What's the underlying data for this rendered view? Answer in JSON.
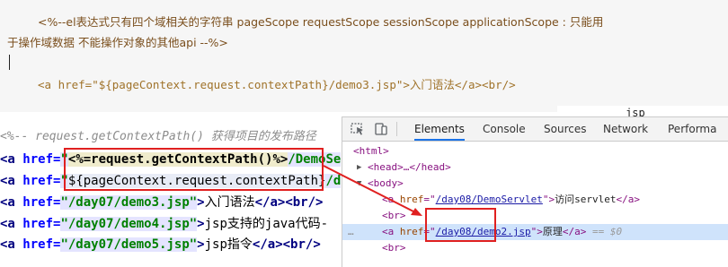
{
  "article": {
    "line1": "<%--el表达式只有四个域相关的字符串 pageScope requestScope sessionScope applicationScope : 只能用",
    "line2": "于操作域数据 不能操作对象的其他api --%>",
    "line3": "<a href=\"${pageContext.request.contextPath}/demo3.jsp\">入门语法</a><br/>"
  },
  "editor": {
    "comment": "<%-- request.getContextPath() 获得项目的发布路径",
    "line1": {
      "open": "<a ",
      "attr": "href=",
      "quote": "\"",
      "jsp": "<%=request.getContextPath()%>",
      "rest": "/DemoSe"
    },
    "line2": {
      "open": "<a ",
      "attr": "href=",
      "quote": "\"",
      "el": "${pageContext.request.contextPath}",
      "rest": "/d"
    },
    "line3": {
      "open": "<a ",
      "attr": "href=",
      "val": "\"/day07/demo3.jsp\"",
      "close": ">",
      "text": "入门语法",
      "end": "</a><br/>"
    },
    "line4": {
      "open": "<a ",
      "attr": "href=",
      "val": "\"/day07/demo4.jsp\"",
      "close": ">",
      "text": "jsp支持的java代码-"
    },
    "line5": {
      "open": "<a ",
      "attr": "href=",
      "val": "\"/day07/demo5.jsp\"",
      "close": ">",
      "text": "jsp指令",
      "end": "</a><br/>"
    }
  },
  "devtools": {
    "window_title": "jsp",
    "tabs": [
      "Elements",
      "Console",
      "Sources",
      "Network",
      "Performa"
    ],
    "active_tab": "Elements",
    "dom": {
      "html": "<html>",
      "head": "<head>…</head>",
      "body": "<body>",
      "a1_href": "/day08/DemoServlet",
      "a1_text": "访问servlet",
      "br": "<br>",
      "a2_href": "/day08/demo2.jsp",
      "a2_text": "原理",
      "a2_eq": "== $0",
      "a_open": "<a ",
      "href_attr": "href",
      "eq_quote": "=\"",
      "close_quote": "\"",
      "gt": ">",
      "a_close": "</a>"
    }
  },
  "colors": {
    "highlight_row": "#cfe3fb",
    "red_box": "#e02020",
    "active_tab_underline": "#1a73e8"
  }
}
